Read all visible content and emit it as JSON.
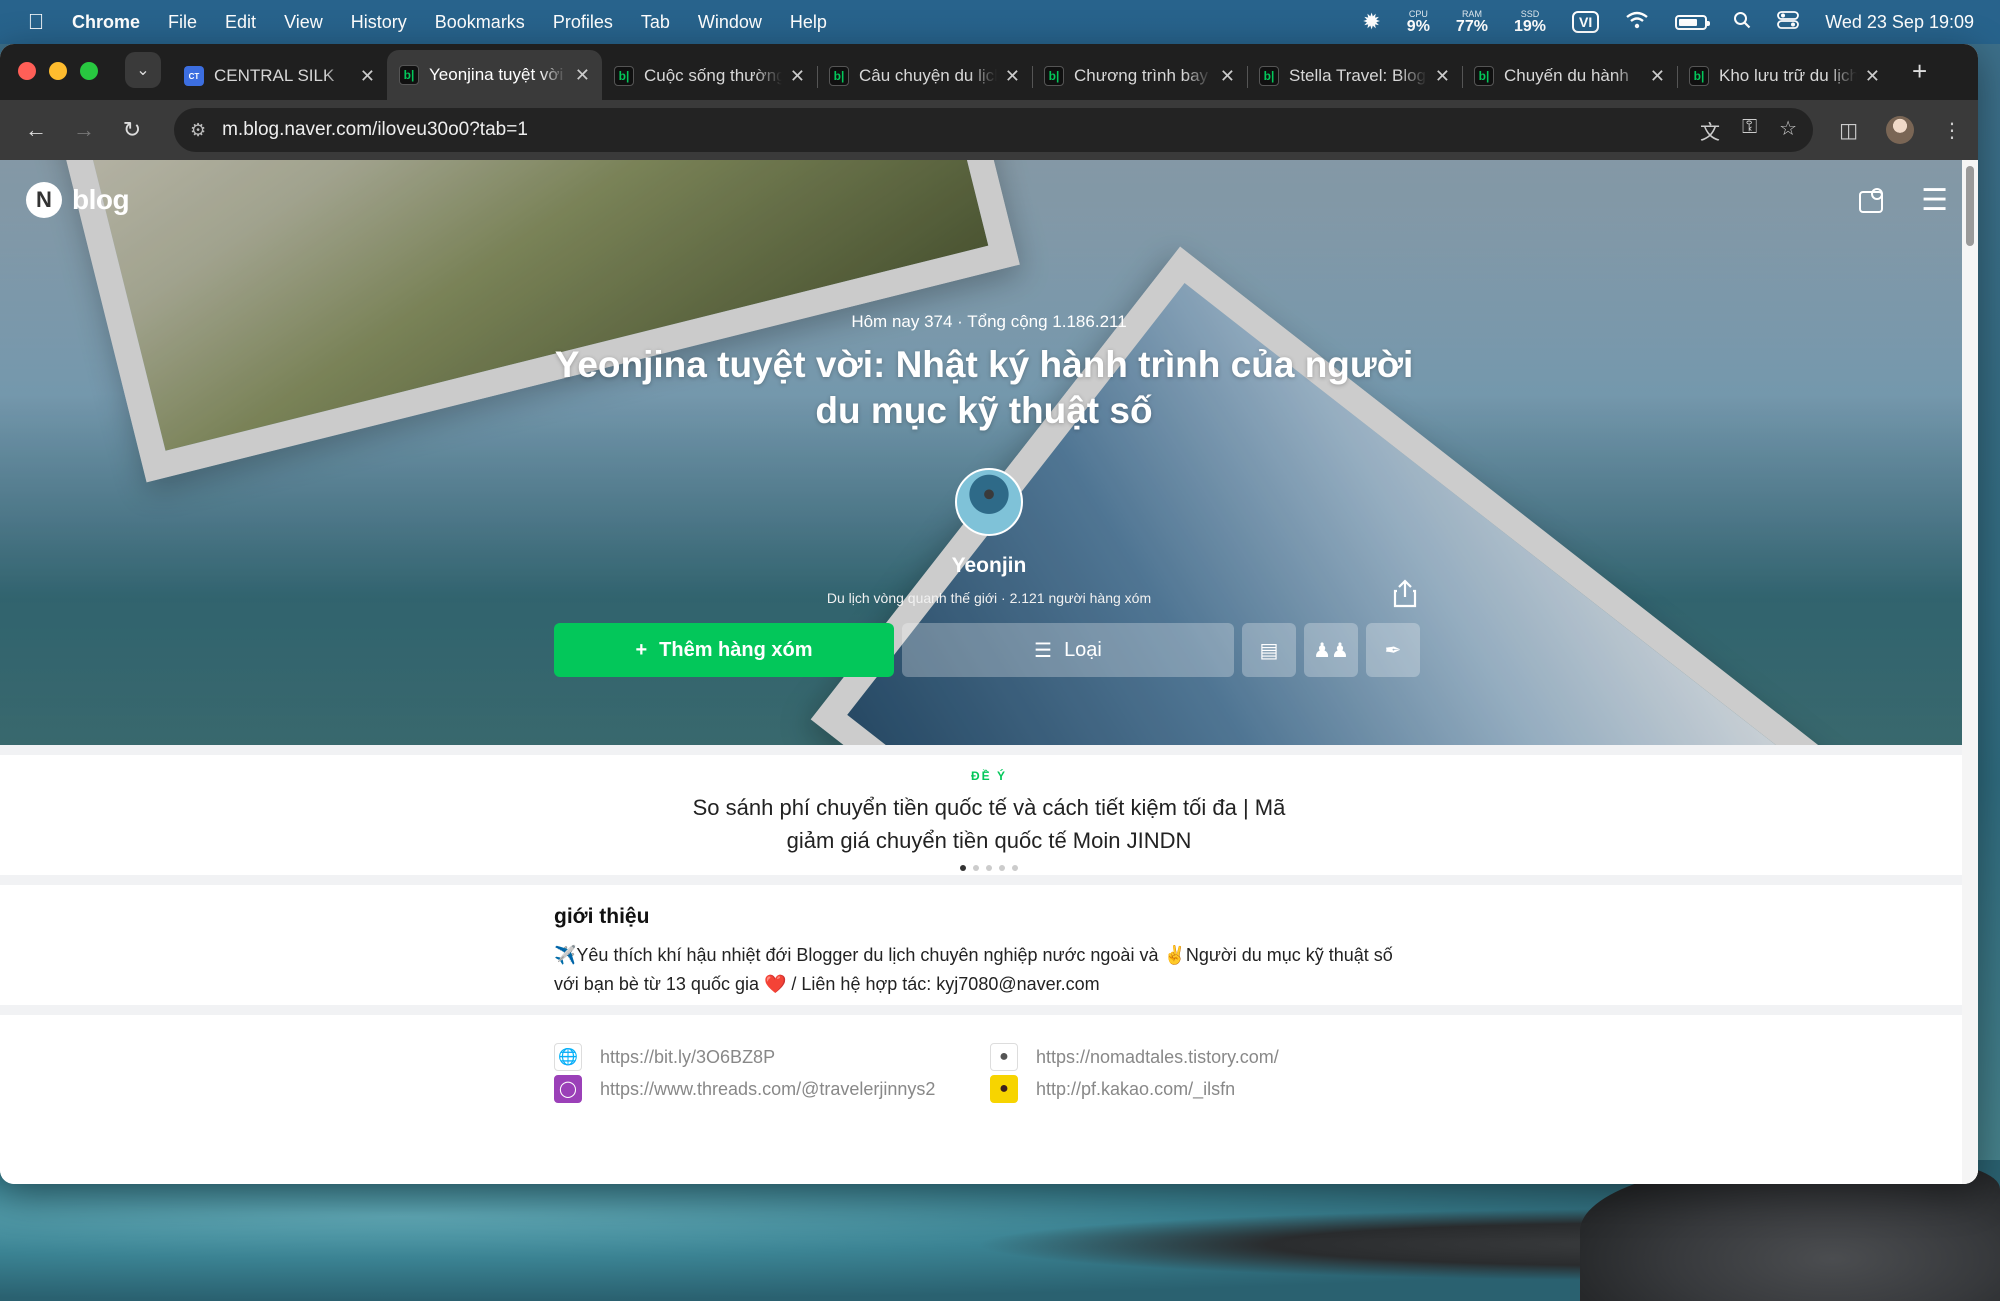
{
  "menubar": {
    "app_name": "Chrome",
    "items": [
      "File",
      "Edit",
      "View",
      "History",
      "Bookmarks",
      "Profiles",
      "Tab",
      "Window",
      "Help"
    ],
    "cpu_label": "CPU",
    "cpu_value": "9%",
    "ram_label": "RAM",
    "ram_value": "77%",
    "ssd_label": "SSD",
    "ssd_value": "19%",
    "input_source": "VI",
    "datetime": "Wed 23 Sep  19:09"
  },
  "browser": {
    "tabs": [
      {
        "title": "CENTRAL SILK",
        "favicon": "CT",
        "favicon_type": "ct"
      },
      {
        "title": "Yeonjina tuyệt vời",
        "favicon": "b|",
        "favicon_type": "b"
      },
      {
        "title": "Cuộc sống thường",
        "favicon": "b|",
        "favicon_type": "b"
      },
      {
        "title": "Câu chuyện du lịch",
        "favicon": "b|",
        "favicon_type": "b"
      },
      {
        "title": "Chương trình bay",
        "favicon": "b|",
        "favicon_type": "b"
      },
      {
        "title": "Stella Travel: Blog",
        "favicon": "b|",
        "favicon_type": "b"
      },
      {
        "title": "Chuyến du hành",
        "favicon": "b|",
        "favicon_type": "b"
      },
      {
        "title": "Kho lưu trữ du lịch",
        "favicon": "b|",
        "favicon_type": "b"
      }
    ],
    "active_tab_index": 1,
    "url": "m.blog.naver.com/iloveu30o0?tab=1"
  },
  "blog": {
    "logo_text": "blog",
    "visit_count": "Hôm nay 374 · Tổng cộng 1.186.211",
    "title": "Yeonjina tuyệt vời: Nhật ký hành trình của người du mục kỹ thuật số",
    "author_name": "Yeonjin",
    "author_sub": "Du lịch vòng quanh thế giới · 2.121 người hàng xóm",
    "follow_button": "Thêm hàng xóm",
    "category_button": "Loại"
  },
  "suggestion": {
    "tag": "ĐỀ Ý",
    "text": "So sánh phí chuyển tiền quốc tế và cách tiết kiệm tối đa | Mã giảm giá chuyển tiền quốc tế Moin JINDN",
    "dots": 5,
    "active_dot": 0
  },
  "intro": {
    "heading": "giới thiệu",
    "body": "✈️Yêu thích khí hậu nhiệt đới Blogger du lịch chuyên nghiệp nước ngoài và ✌️Người du mục kỹ thuật số với bạn bè từ 13 quốc gia ❤️ / Liên hệ hợp tác: kyj7080@naver.com"
  },
  "links": [
    {
      "url": "https://bit.ly/3O6BZ8P",
      "icon": "globe-icon"
    },
    {
      "url": "https://nomadtales.tistory.com/",
      "icon": "tistory-icon"
    },
    {
      "url": "https://www.threads.com/@travelerjinnys2",
      "icon": "instagram-icon"
    },
    {
      "url": "http://pf.kakao.com/_ilsfn",
      "icon": "kakao-icon"
    }
  ],
  "colors": {
    "naver_green": "#03c75a",
    "menubar": "#26628c",
    "chrome_dark": "#1f1f1f"
  }
}
